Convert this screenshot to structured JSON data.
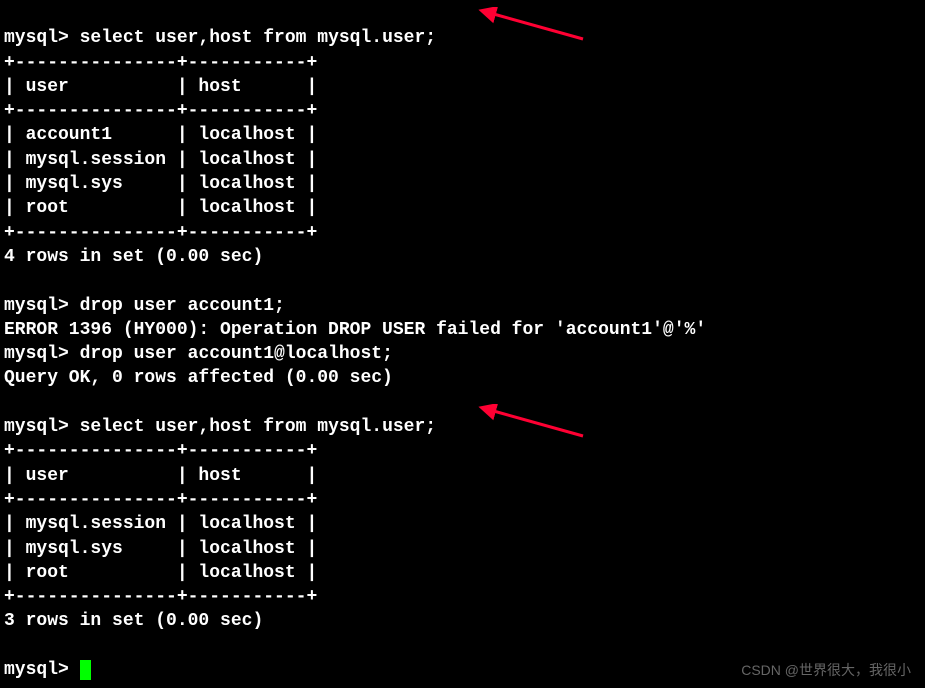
{
  "terminal": {
    "prompt": "mysql>",
    "commands": {
      "select1": "select user,host from mysql.user;",
      "drop1": "drop user account1;",
      "drop2": "drop user account1@localhost;",
      "select2": "select user,host from mysql.user;"
    },
    "table1": {
      "border_top": "+---------------+-----------+",
      "header": "| user          | host      |",
      "border_mid": "+---------------+-----------+",
      "row1": "| account1      | localhost |",
      "row2": "| mysql.session | localhost |",
      "row3": "| mysql.sys     | localhost |",
      "row4": "| root          | localhost |",
      "border_bot": "+---------------+-----------+",
      "summary": "4 rows in set (0.00 sec)"
    },
    "error": "ERROR 1396 (HY000): Operation DROP USER failed for 'account1'@'%'",
    "ok": "Query OK, 0 rows affected (0.00 sec)",
    "table2": {
      "border_top": "+---------------+-----------+",
      "header": "| user          | host      |",
      "border_mid": "+---------------+-----------+",
      "row1": "| mysql.session | localhost |",
      "row2": "| mysql.sys     | localhost |",
      "row3": "| root          | localhost |",
      "border_bot": "+---------------+-----------+",
      "summary": "3 rows in set (0.00 sec)"
    }
  },
  "watermark": "CSDN @世界很大，我很小",
  "arrows": {
    "color": "#ff0033"
  }
}
